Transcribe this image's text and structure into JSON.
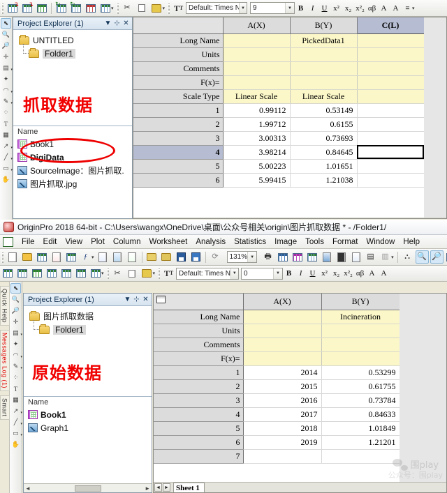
{
  "top_window": {
    "font_toolbar": {
      "font_icon": "font-icon",
      "font_name": "Default: Times Nev",
      "font_size": "9",
      "bold": "B",
      "italic": "I",
      "underline": "U",
      "superscript": "x²",
      "subscript": "x₂",
      "subsup": "x²₂",
      "greek": "αβ",
      "increase_font": "A",
      "decrease_font": "A",
      "align": "≡"
    },
    "toolbar_icons": [
      "new-worksheet-icon",
      "new-workbook-icon",
      "new-matrix-icon",
      "add-sheet-icon",
      "add-columns-icon",
      "transpose-icon",
      "duplicate-icon",
      "cut-icon",
      "copy-icon",
      "paste-icon"
    ],
    "left_tools": [
      "pointer-icon",
      "zoom-in-icon",
      "zoom-out-icon",
      "screen-reader-icon",
      "data-selector-icon",
      "mask-icon",
      "region-icon",
      "annotation-icon",
      "scatter-icon",
      "text-icon",
      "table-icon",
      "arrow-icon",
      "line-icon",
      "rect-icon",
      "hand-icon"
    ],
    "project_explorer": {
      "title": "Project Explorer (1)",
      "menu_icon": "chevron-down-icon",
      "pin_icon": "pin-icon",
      "close_icon": "close-icon",
      "tree": [
        {
          "label": "UNTITLED",
          "selected": false
        },
        {
          "label": "Folder1",
          "selected": true
        }
      ],
      "annotation": "抓取数据",
      "annotation_color": "#f10000",
      "list_header": "Name",
      "items": [
        {
          "label": "Book1",
          "icon": "workbook-icon",
          "bold": false,
          "circled": false
        },
        {
          "label": "DigiData",
          "icon": "workbook-icon",
          "bold": true,
          "circled": true
        },
        {
          "label": "SourceImage：图片抓取.",
          "icon": "image-icon",
          "bold": false,
          "circled": false
        },
        {
          "label": "图片抓取.jpg",
          "icon": "image-icon",
          "bold": false,
          "circled": false
        }
      ]
    },
    "worksheet": {
      "columns": [
        {
          "label": "A(X)",
          "selected": false
        },
        {
          "label": "B(Y)",
          "selected": false
        },
        {
          "label": "C(L)",
          "selected": true
        }
      ],
      "meta_rows": [
        {
          "label": "Long Name",
          "values": [
            "",
            "PickedData1",
            ""
          ]
        },
        {
          "label": "Units",
          "values": [
            "",
            "",
            ""
          ]
        },
        {
          "label": "Comments",
          "values": [
            "",
            "",
            ""
          ]
        },
        {
          "label": "F(x)=",
          "values": [
            "",
            "",
            ""
          ]
        },
        {
          "label": "Scale Type",
          "values": [
            "Linear Scale",
            "Linear Scale",
            ""
          ]
        }
      ],
      "data_rows": [
        {
          "n": "1",
          "values": [
            "0.99112",
            "0.53149",
            ""
          ],
          "selected": false
        },
        {
          "n": "2",
          "values": [
            "1.99712",
            "0.6155",
            ""
          ],
          "selected": false
        },
        {
          "n": "3",
          "values": [
            "3.00313",
            "0.73693",
            ""
          ],
          "selected": false
        },
        {
          "n": "4",
          "values": [
            "3.98214",
            "0.84645",
            ""
          ],
          "selected": true
        },
        {
          "n": "5",
          "values": [
            "5.00223",
            "1.01651",
            ""
          ],
          "selected": false
        },
        {
          "n": "6",
          "values": [
            "5.99415",
            "1.21038",
            ""
          ],
          "selected": false
        }
      ],
      "active_cell": "C4"
    }
  },
  "bottom_window": {
    "title": "OriginPro 2018 64-bit - C:\\Users\\wangx\\OneDrive\\桌面\\公众号相关\\origin\\图片抓取数据 * - /Folder1/",
    "app_icon": "origin-logo-icon",
    "menus": [
      "File",
      "Edit",
      "View",
      "Plot",
      "Column",
      "Worksheet",
      "Analysis",
      "Statistics",
      "Image",
      "Tools",
      "Format",
      "Window",
      "Help"
    ],
    "standard_toolbar": {
      "icons": [
        "new-project-icon",
        "open-icon",
        "new-workbook-icon",
        "new-graph-icon",
        "new-matrix-icon",
        "new-function-icon",
        "new-layout-icon",
        "new-notes-icon",
        "new-excel-icon",
        "open-project-icon",
        "open-template-icon",
        "save-project-icon",
        "save-template-icon",
        "refresh-icon"
      ],
      "zoom_value": "131%",
      "zoom_dropdown_icon": "chevron-down-icon",
      "right_icons": [
        "print-icon",
        "import-icon",
        "import-wizard-icon",
        "import-ascii-icon",
        "image-icon",
        "movie-icon",
        "mask-icon",
        "layers-icon",
        "merge-icon",
        "hierarchy-icon",
        "zoom-region-icon",
        "data-reader-icon",
        "worksheet-icon",
        "layout-icon",
        "tools-icon"
      ]
    },
    "font_toolbar": {
      "font_icon": "font-icon",
      "font_name": "Default: Times Nev",
      "font_size": "0",
      "bold": "B",
      "italic": "I",
      "underline": "U",
      "superscript": "x²",
      "subscript": "x₂",
      "subsup": "x²₂",
      "greek": "αβ",
      "increase_font": "A",
      "decrease_font": "A"
    },
    "side_tabs": [
      {
        "label": "Quick Help",
        "color": "#333333"
      },
      {
        "label": "Messages Log (1)",
        "color": "#e00000"
      },
      {
        "label": "Smart",
        "color": "#333333"
      }
    ],
    "left_tools": [
      "pointer-icon",
      "zoom-in-icon",
      "zoom-out-icon",
      "screen-reader-icon",
      "data-selector-icon",
      "mask-icon",
      "region-icon",
      "annotation-icon",
      "scatter-icon",
      "text-icon",
      "table-icon",
      "arrow-icon",
      "line-icon",
      "rect-icon",
      "hand-icon"
    ],
    "project_explorer": {
      "title": "Project Explorer (1)",
      "menu_icon": "chevron-down-icon",
      "pin_icon": "pin-icon",
      "close_icon": "close-icon",
      "tree": [
        {
          "label": "图片抓取数据",
          "selected": false
        },
        {
          "label": "Folder1",
          "selected": true
        }
      ],
      "annotation": "原始数据",
      "annotation_color": "#f10000",
      "list_header": "Name",
      "items": [
        {
          "label": "Book1",
          "icon": "workbook-icon",
          "bold": true
        },
        {
          "label": "Graph1",
          "icon": "graph-icon",
          "bold": false
        }
      ]
    },
    "worksheet": {
      "book_icon": "matrix-book-icon",
      "columns": [
        {
          "label": "A(X)",
          "selected": false
        },
        {
          "label": "B(Y)",
          "selected": false
        }
      ],
      "meta_rows": [
        {
          "label": "Long Name",
          "values": [
            "",
            "Incineration"
          ]
        },
        {
          "label": "Units",
          "values": [
            "",
            ""
          ]
        },
        {
          "label": "Comments",
          "values": [
            "",
            ""
          ]
        },
        {
          "label": "F(x)=",
          "values": [
            "",
            ""
          ]
        }
      ],
      "data_rows": [
        {
          "n": "1",
          "values": [
            "2014",
            "0.53299"
          ]
        },
        {
          "n": "2",
          "values": [
            "2015",
            "0.61755"
          ]
        },
        {
          "n": "3",
          "values": [
            "2016",
            "0.73784"
          ]
        },
        {
          "n": "4",
          "values": [
            "2017",
            "0.84633"
          ]
        },
        {
          "n": "5",
          "values": [
            "2018",
            "1.01849"
          ]
        },
        {
          "n": "6",
          "values": [
            "2019",
            "1.21201"
          ]
        },
        {
          "n": "7",
          "values": [
            "",
            ""
          ]
        }
      ],
      "sheet_tab": "Sheet 1",
      "nav_first": "◄",
      "nav_next": "►"
    },
    "watermark": {
      "text": "围play",
      "sub": "公众号：围play"
    }
  }
}
